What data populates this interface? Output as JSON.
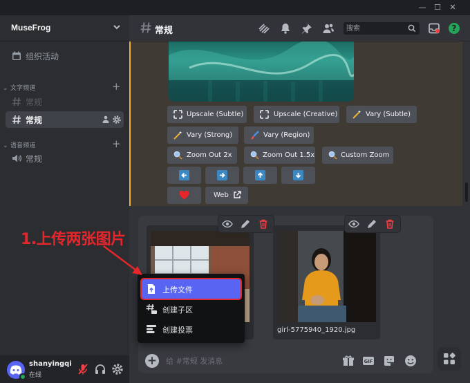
{
  "window": {
    "minimize": "—",
    "maximize": "☐",
    "close": "✕"
  },
  "sidebar": {
    "server_name": "MuseFrog",
    "events_label": "组织活动",
    "text_category": "文字频道",
    "text_channels": [
      {
        "label": "常规"
      },
      {
        "label": "常规"
      }
    ],
    "voice_category": "语音频道",
    "voice_channels": [
      {
        "label": "常规"
      }
    ]
  },
  "user": {
    "name": "shanyingqi",
    "status": "在线"
  },
  "header": {
    "channel": "常规",
    "search_placeholder": "搜索"
  },
  "midjourney": {
    "buttons": [
      {
        "label": "Upscale (Subtle)",
        "icon": "upscale-icon"
      },
      {
        "label": "Upscale (Creative)",
        "icon": "upscale-icon"
      },
      {
        "label": "Vary (Subtle)",
        "icon": "magic-wand-icon"
      },
      {
        "label": "Vary (Strong)",
        "icon": "magic-wand-icon"
      },
      {
        "label": "Vary (Region)",
        "icon": "paintbrush-icon"
      },
      {
        "label": "Zoom Out 2x",
        "icon": "magnifier-icon"
      },
      {
        "label": "Zoom Out 1.5x",
        "icon": "magnifier-icon"
      },
      {
        "label": "Custom Zoom",
        "icon": "magnifier-icon"
      },
      {
        "label": "",
        "icon": "arrow-left-icon"
      },
      {
        "label": "",
        "icon": "arrow-right-icon"
      },
      {
        "label": "",
        "icon": "arrow-up-icon"
      },
      {
        "label": "",
        "icon": "arrow-down-icon"
      },
      {
        "label": "",
        "icon": "heart-icon"
      },
      {
        "label": "Web",
        "icon": "external-link-icon"
      }
    ]
  },
  "attachments": [
    {
      "name": ""
    },
    {
      "name": "girl-5775940_1920.jpg"
    }
  ],
  "composer": {
    "placeholder": "给 #常规 发消息"
  },
  "menu": {
    "items": [
      {
        "label": "上传文件",
        "icon": "upload-file-icon"
      },
      {
        "label": "创建子区",
        "icon": "thread-icon"
      },
      {
        "label": "创建投票",
        "icon": "poll-icon"
      }
    ]
  },
  "annotation": {
    "text": "1.上传两张图片"
  },
  "colors": {
    "accent": "#5865f2",
    "annotation": "#e5262b",
    "online": "#23a55a",
    "heart": "#e5262b"
  }
}
